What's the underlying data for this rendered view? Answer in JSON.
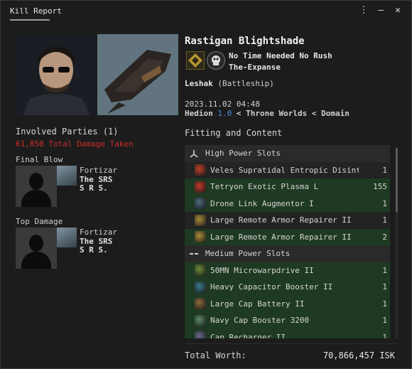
{
  "window": {
    "title": "Kill Report",
    "controls": [
      "⋮",
      "–",
      "✕"
    ]
  },
  "victim": {
    "name": "Rastigan Blightshade",
    "corp": "No Time Needed No Rush",
    "alliance": "The-Expanse",
    "ship_name": "Leshak",
    "ship_class": "(Battleship)",
    "datetime": "2023.11.02 04:48",
    "system": "Hedion",
    "security": "1.0",
    "region_sep1": "<",
    "constellation": "Throne Worlds",
    "region_sep2": "<",
    "region": "Domain"
  },
  "involved": {
    "header": "Involved Parties (1)",
    "damage_taken": "61,850 Total Damage Taken",
    "final_blow": {
      "label": "Final Blow",
      "ship": "Fortizar",
      "corp_line1": "The SRS",
      "corp_line2": "S R S."
    },
    "top_damage": {
      "label": "Top Damage",
      "ship": "Fortizar",
      "corp_line1": "The SRS",
      "corp_line2": "S R S."
    }
  },
  "fitting": {
    "header": "Fitting and Content",
    "rows": [
      {
        "kind": "header",
        "label": "High Power Slots",
        "icon": "high-slot-icon"
      },
      {
        "kind": "item",
        "label": "Veles Supratidal Entropic Disintegrator",
        "qty": "1",
        "dropped": false,
        "color": "#b8402a"
      },
      {
        "kind": "item",
        "label": "Tetryon Exotic Plasma L",
        "qty": "155",
        "dropped": true,
        "color": "#c0392b"
      },
      {
        "kind": "item",
        "label": "Drone Link Augmentor I",
        "qty": "1",
        "dropped": true,
        "color": "#4a6a7a"
      },
      {
        "kind": "item",
        "label": "Large Remote Armor Repairer II",
        "qty": "1",
        "dropped": false,
        "color": "#a88a3a"
      },
      {
        "kind": "item",
        "label": "Large Remote Armor Repairer II",
        "qty": "2",
        "dropped": true,
        "color": "#a88a3a"
      },
      {
        "kind": "header",
        "label": "Medium Power Slots",
        "icon": "mid-slot-icon"
      },
      {
        "kind": "item",
        "label": "50MN Microwarpdrive II",
        "qty": "1",
        "dropped": true,
        "color": "#6a8a3a"
      },
      {
        "kind": "item",
        "label": "Heavy Capacitor Booster II",
        "qty": "1",
        "dropped": true,
        "color": "#3a7a8a"
      },
      {
        "kind": "item",
        "label": "Large Cap Battery II",
        "qty": "1",
        "dropped": true,
        "color": "#8a6a3a"
      },
      {
        "kind": "item",
        "label": "Navy Cap Booster 3200",
        "qty": "1",
        "dropped": true,
        "color": "#5a8a6a"
      },
      {
        "kind": "item",
        "label": "Cap Recharger II",
        "qty": "1",
        "dropped": true,
        "color": "#6a6a8a"
      }
    ]
  },
  "total": {
    "label": "Total Worth:",
    "value": "70,866,457 ISK"
  }
}
